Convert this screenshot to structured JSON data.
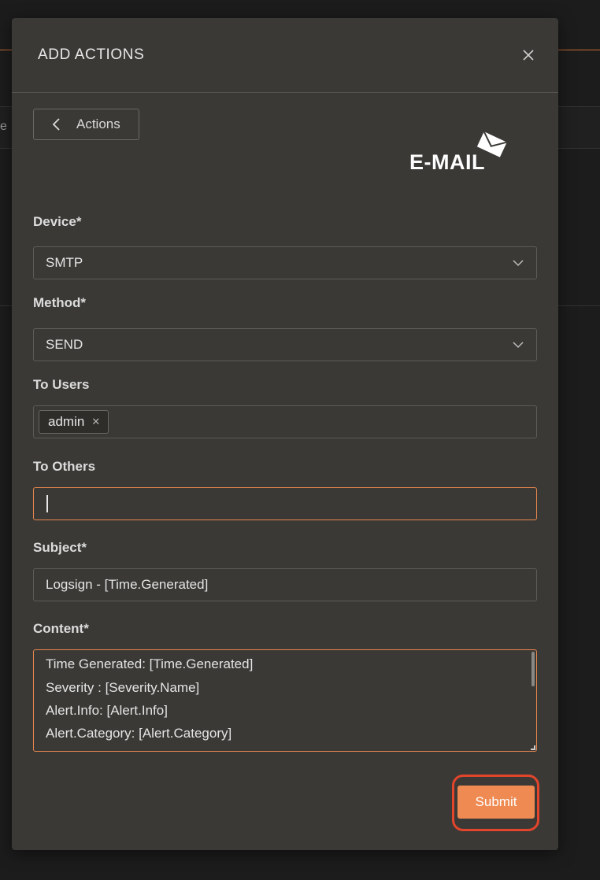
{
  "background": {
    "strip_text": "e"
  },
  "modal": {
    "title": "ADD ACTIONS",
    "back_label": "Actions",
    "logo_text": "E-MAIL"
  },
  "form": {
    "device": {
      "label": "Device*",
      "value": "SMTP"
    },
    "method": {
      "label": "Method*",
      "value": "SEND"
    },
    "to_users": {
      "label": "To Users",
      "tags": [
        "admin"
      ]
    },
    "to_others": {
      "label": "To Others",
      "value": ""
    },
    "subject": {
      "label": "Subject*",
      "value": "Logsign - [Time.Generated]"
    },
    "content": {
      "label": "Content*",
      "lines": [
        "Time Generated: [Time.Generated]",
        "Severity : [Severity.Name]",
        "Alert.Info: [Alert.Info]",
        "Alert.Category: [Alert.Category]"
      ]
    }
  },
  "actions": {
    "submit_label": "Submit"
  },
  "colors": {
    "accent": "#ee8a52",
    "highlight_ring": "#e2452b",
    "modal_bg": "#3a3936"
  }
}
